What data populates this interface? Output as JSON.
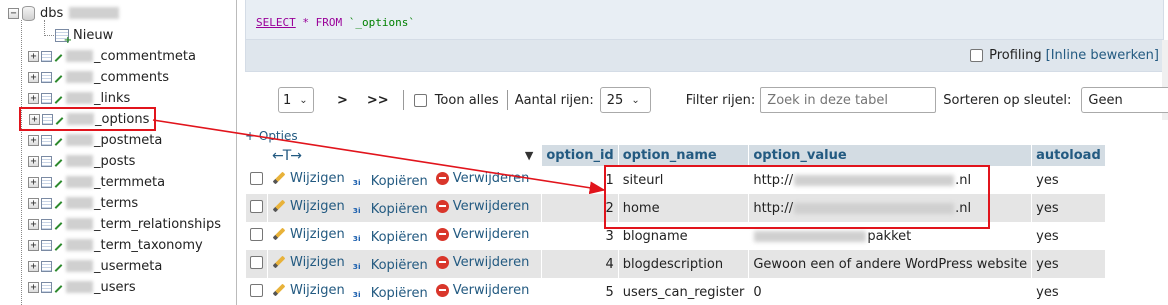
{
  "nav": {
    "db_name": "dbs",
    "new_label": "Nieuw",
    "tables": [
      "_commentmeta",
      "_comments",
      "_links",
      "_options",
      "_postmeta",
      "_posts",
      "_termmeta",
      "_terms",
      "_term_relationships",
      "_term_taxonomy",
      "_usermeta",
      "_users"
    ],
    "selected_table": "_options"
  },
  "sql": {
    "select": "SELECT",
    "star": " * ",
    "from": "FROM",
    "table": " `_options`"
  },
  "profiling": {
    "label": "Profiling",
    "inline_edit": "[Inline bewerken]"
  },
  "toolbar": {
    "page_value": "1",
    "next": ">",
    "last": ">>",
    "show_all": "Toon alles",
    "rows_label": "Aantal rijen:",
    "rows_value": "25",
    "filter_label": "Filter rijen:",
    "filter_placeholder": "Zoek in deze tabel",
    "sort_label": "Sorteren op sleutel:",
    "sort_value": "Geen"
  },
  "options_link": "+ Opties",
  "columns": {
    "sort_glyph": "▼",
    "option_id": "option_id",
    "option_name": "option_name",
    "option_value": "option_value",
    "autoload": "autoload"
  },
  "actions": {
    "edit": "Wijzigen",
    "copy": "Kopiëren",
    "delete": "Verwijderen"
  },
  "rows": [
    {
      "option_id": "1",
      "option_name": "siteurl",
      "value_prefix": "http://",
      "value_suffix": ".nl",
      "autoload": "yes"
    },
    {
      "option_id": "2",
      "option_name": "home",
      "value_prefix": "http://",
      "value_suffix": ".nl",
      "autoload": "yes"
    },
    {
      "option_id": "3",
      "option_name": "blogname",
      "value_prefix": "",
      "value_suffix": "pakket",
      "autoload": "yes"
    },
    {
      "option_id": "4",
      "option_name": "blogdescription",
      "value_prefix": "Gewoon een of andere WordPress website",
      "value_suffix": "",
      "autoload": "yes"
    },
    {
      "option_id": "5",
      "option_name": "users_can_register",
      "value_prefix": "0",
      "value_suffix": "",
      "autoload": "yes"
    }
  ],
  "colors": {
    "highlight": "#e1141c",
    "link": "#235a81",
    "header_bg": "#d3dce3"
  }
}
